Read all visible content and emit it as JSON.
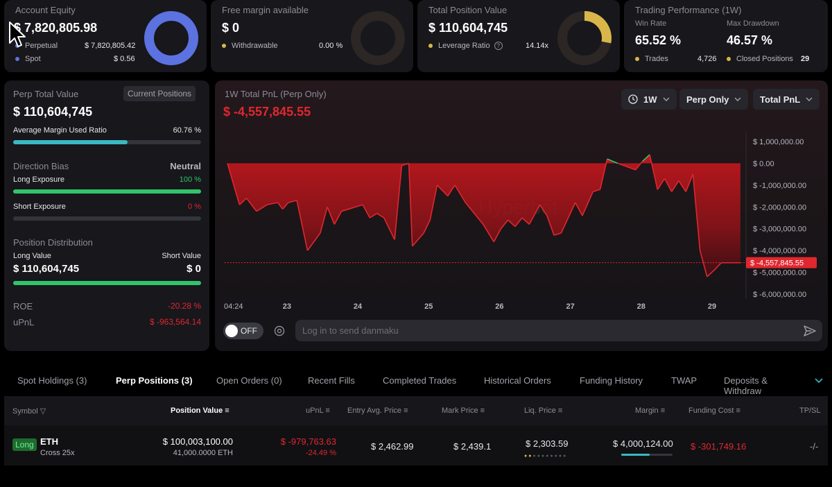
{
  "top_cards": {
    "equity": {
      "title": "Account Equity",
      "value": "$ 7,820,805.98",
      "row1_label": "Perpetual",
      "row1_value": "$ 7,820,805.42",
      "row2_label": "Spot",
      "row2_value": "$ 0.56",
      "donut_fraction": 1.0
    },
    "free_margin": {
      "title": "Free margin available",
      "value": "$ 0",
      "row1_label": "Withdrawable",
      "row1_value": "0.00 %",
      "donut_fraction": 0.0
    },
    "position_value": {
      "title": "Total Position Value",
      "value": "$ 110,604,745",
      "row1_label": "Leverage Ratio",
      "row1_value": "14.14x",
      "donut_fraction": 0.28
    },
    "performance": {
      "title": "Trading Performance (1W)",
      "win_label": "Win Rate",
      "win_value": "65.52 %",
      "dd_label": "Max Drawdown",
      "dd_value": "46.57 %",
      "trades_label": "Trades",
      "trades_value": "4,726",
      "closed_label": "Closed Positions",
      "closed_value": "29"
    }
  },
  "left_panel": {
    "title": "Perp Total Value",
    "current_positions_btn": "Current Positions",
    "value": "$ 110,604,745",
    "margin_label": "Average Margin Used Ratio",
    "margin_value": "60.76 %",
    "margin_fraction": 0.6076,
    "bias_label": "Direction Bias",
    "bias_value": "Neutral",
    "long_label": "Long Exposure",
    "long_value": "100 %",
    "long_fraction": 1.0,
    "short_label": "Short Exposure",
    "short_value": "0 %",
    "short_fraction": 0.0,
    "dist_label": "Position Distribution",
    "long_value_label": "Long Value",
    "short_value_label": "Short Value",
    "long_amount": "$ 110,604,745",
    "short_amount": "$ 0",
    "dist_fraction": 1.0,
    "roe_label": "ROE",
    "roe_value": "-20.28 %",
    "upnl_label": "uPnL",
    "upnl_value": "$ -963,564.14"
  },
  "chart_panel": {
    "title": "1W Total PnL (Perp Only)",
    "value": "$ -4,557,845.55",
    "dropdown_period": "1W",
    "dropdown_scope": "Perp Only",
    "dropdown_metric": "Total PnL",
    "toggle_label": "OFF",
    "danmaku_placeholder": "Log in to send danmaku",
    "watermark": "Hyperbot"
  },
  "chart_data": {
    "type": "area",
    "title": "1W Total PnL (Perp Only)",
    "current_value": -4557845.55,
    "current_label": "$ -4,557,845.55",
    "ylim": [
      -6000000,
      1000000
    ],
    "y_ticks": [
      1000000,
      0,
      -1000000,
      -2000000,
      -3000000,
      -4000000,
      -5000000,
      -6000000
    ],
    "y_tick_labels": [
      "$ 1,000,000.00",
      "$ 0.00",
      "$ -1,000,000.00",
      "$ -2,000,000.00",
      "$ -3,000,000.00",
      "$ -4,000,000.00",
      "$ -5,000,000.00",
      "$ -6,000,000.00"
    ],
    "x_tick_labels": [
      {
        "t": 0,
        "label": "04:24"
      },
      {
        "t": 0.84,
        "label": "23"
      },
      {
        "t": 1.84,
        "label": "24"
      },
      {
        "t": 2.84,
        "label": "25"
      },
      {
        "t": 3.84,
        "label": "26"
      },
      {
        "t": 4.84,
        "label": "27"
      },
      {
        "t": 5.84,
        "label": "28"
      },
      {
        "t": 6.84,
        "label": "29"
      }
    ],
    "x_span": [
      0,
      7.3
    ],
    "series": [
      {
        "values": [
          [
            0.0,
            0.0
          ],
          [
            0.17,
            -1.9
          ],
          [
            0.27,
            -1.6
          ],
          [
            0.41,
            -2.2
          ],
          [
            0.56,
            -1.9
          ],
          [
            0.71,
            -1.8
          ],
          [
            0.78,
            -2.1
          ],
          [
            0.86,
            -1.8
          ],
          [
            0.98,
            -1.7
          ],
          [
            1.13,
            -4.0
          ],
          [
            1.31,
            -3.2
          ],
          [
            1.41,
            -2.0
          ],
          [
            1.51,
            -2.8
          ],
          [
            1.61,
            -2.2
          ],
          [
            1.81,
            -2.0
          ],
          [
            1.91,
            -1.9
          ],
          [
            2.01,
            -2.5
          ],
          [
            2.11,
            -2.3
          ],
          [
            2.21,
            -2.5
          ],
          [
            2.36,
            -3.5
          ],
          [
            2.46,
            -0.1
          ],
          [
            2.56,
            0.0
          ],
          [
            2.61,
            -3.8
          ],
          [
            2.77,
            -3.2
          ],
          [
            2.86,
            -2.6
          ],
          [
            2.96,
            -1.0
          ],
          [
            3.11,
            -1.5
          ],
          [
            3.21,
            -1.0
          ],
          [
            3.36,
            -1.8
          ],
          [
            3.46,
            -2.2
          ],
          [
            3.61,
            -2.8
          ],
          [
            3.76,
            -3.6
          ],
          [
            3.86,
            -3.0
          ],
          [
            3.96,
            -2.6
          ],
          [
            4.06,
            -2.9
          ],
          [
            4.16,
            -2.5
          ],
          [
            4.26,
            -2.8
          ],
          [
            4.41,
            -1.9
          ],
          [
            4.51,
            -2.4
          ],
          [
            4.61,
            -3.3
          ],
          [
            4.71,
            -3.2
          ],
          [
            4.81,
            -2.5
          ],
          [
            4.91,
            -1.8
          ],
          [
            5.01,
            -2.4
          ],
          [
            5.16,
            -1.3
          ],
          [
            5.26,
            -1.2
          ],
          [
            5.36,
            0.2
          ],
          [
            5.51,
            0.0
          ],
          [
            5.76,
            -0.3
          ],
          [
            5.86,
            0.1
          ],
          [
            5.96,
            0.4
          ],
          [
            6.07,
            -1.2
          ],
          [
            6.17,
            -0.7
          ],
          [
            6.27,
            -1.3
          ],
          [
            6.37,
            -0.8
          ],
          [
            6.47,
            -1.3
          ],
          [
            6.57,
            -0.5
          ],
          [
            6.67,
            -4.0
          ],
          [
            6.77,
            -5.2
          ],
          [
            6.87,
            -4.9
          ],
          [
            6.97,
            -4.56
          ],
          [
            7.24,
            -4.56
          ]
        ]
      }
    ]
  },
  "tabs": [
    "Spot Holdings (3)",
    "Perp Positions (3)",
    "Open Orders (0)",
    "Recent Fills",
    "Completed Trades",
    "Historical Orders",
    "Funding History",
    "TWAP",
    "Deposits & Withdraw"
  ],
  "active_tab": 1,
  "table": {
    "headers": {
      "symbol": "Symbol",
      "position_value": "Position Value",
      "upnl": "uPnL",
      "entry": "Entry Avg. Price",
      "mark": "Mark Price",
      "liq": "Liq. Price",
      "margin": "Margin",
      "funding": "Funding Cost",
      "tpsl": "TP/SL"
    },
    "rows": [
      {
        "side": "Long",
        "symbol": "ETH",
        "mode": "Cross 25x",
        "position_value": "$ 100,003,100.00",
        "position_size": "41,000.0000 ETH",
        "upnl": "$ -979,763.63",
        "upnl_pct": "-24.49 %",
        "entry": "$ 2,462.99",
        "mark": "$ 2,439.1",
        "liq": "$ 2,303.59",
        "margin": "$ 4,000,124.00",
        "margin_fraction": 0.55,
        "funding": "$ -301,749.16",
        "tpsl": "-/-"
      }
    ]
  },
  "colors": {
    "accent_blue": "#5b72e0",
    "gold": "#d9b64a",
    "teal": "#3bb8c4",
    "green": "#31c46b",
    "red": "#e0272f"
  }
}
